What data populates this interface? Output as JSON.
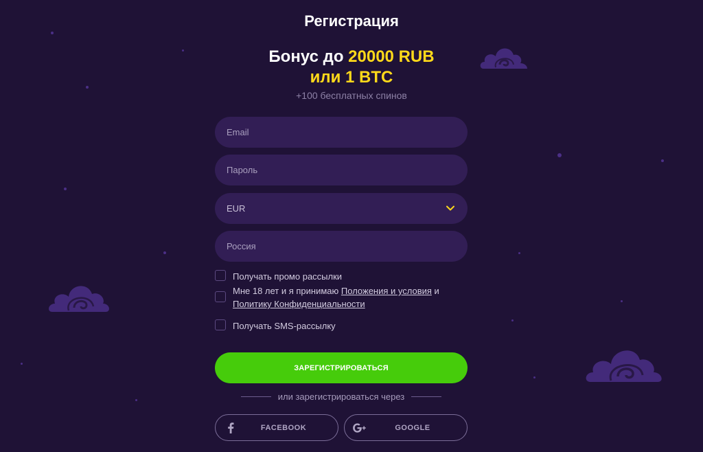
{
  "title": "Регистрация",
  "bonus": {
    "prefix": "Бонус до ",
    "amount": "20000 RUB",
    "or_btc": "или 1 BTC",
    "spins": "+100 бесплатных спинов"
  },
  "form": {
    "email_placeholder": "Email",
    "password_placeholder": "Пароль",
    "currency_value": "EUR",
    "country_placeholder": "Россия"
  },
  "checkboxes": {
    "promo_label": "Получать промо рассылки",
    "terms_prefix": "Мне 18 лет и я принимаю ",
    "terms_link": "Положения и условия",
    "terms_and": " и",
    "privacy_link": "Политику Конфиденциальности",
    "sms_label": "Получать SMS-рассылку"
  },
  "register_button": "ЗАРЕГИСТРИРОВАТЬСЯ",
  "or_text": "или зарегистрироваться через",
  "social": {
    "facebook": "FACEBOOK",
    "google": "GOOGLE"
  },
  "icons": [
    "chevron-down-icon",
    "facebook-icon",
    "google-plus-icon",
    "cloud-decoration"
  ],
  "colors": {
    "background": "#1f1236",
    "field": "#321e55",
    "accent_yellow": "#ffd91a",
    "button_green": "#46cc0b"
  }
}
